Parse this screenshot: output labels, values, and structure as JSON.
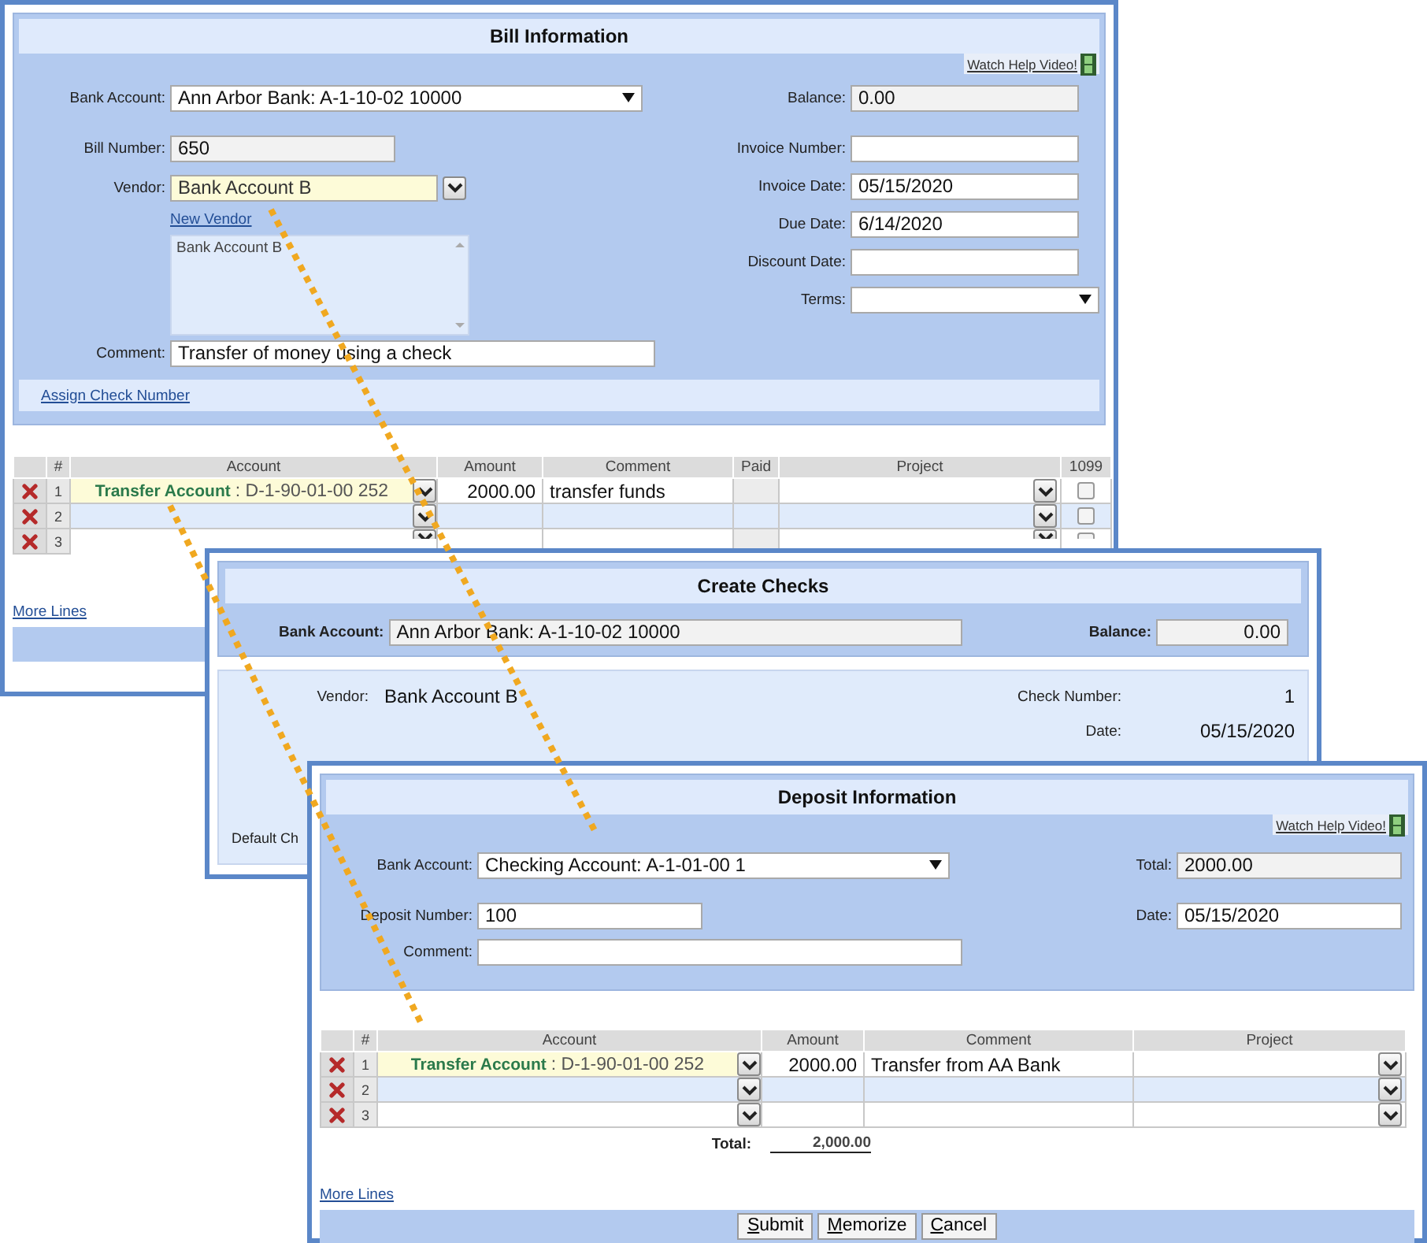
{
  "bill": {
    "title": "Bill Information",
    "help_link": "Watch Help Video!",
    "bank_account": {
      "label": "Bank Account:",
      "value": "Ann Arbor Bank: A-1-10-02 10000"
    },
    "bill_number": {
      "label": "Bill Number:",
      "value": "650"
    },
    "vendor": {
      "label": "Vendor:",
      "value": "Bank Account B"
    },
    "new_vendor_link": "New Vendor",
    "vendor_list": [
      "Bank Account B"
    ],
    "comment": {
      "label": "Comment:",
      "value": "Transfer of money using a check"
    },
    "right_fields": [
      {
        "label": "Balance:",
        "value": "0.00",
        "kind": "readonly"
      },
      {
        "label": "Invoice Number:",
        "kind": "text"
      },
      {
        "label": "Invoice Date:",
        "value": "05/15/2020",
        "kind": "text"
      },
      {
        "label": "Due Date:",
        "value": "6/14/2020",
        "kind": "text"
      },
      {
        "label": "Discount Date:",
        "kind": "text"
      },
      {
        "label": "Terms:",
        "kind": "select"
      }
    ],
    "assign_link": "Assign Check Number",
    "columns": [
      "#",
      "Account",
      "Amount",
      "Comment",
      "Paid",
      "Project",
      "1099"
    ],
    "rows": [
      {
        "number": "1",
        "highlighted": true,
        "account_name": "Transfer Account",
        "account_code": ": D-1-90-01-00 252",
        "amount": "2000.00",
        "comment": "transfer funds",
        "form_1099": false
      },
      {
        "number": "2",
        "highlighted": false,
        "form_1099": false
      },
      {
        "number": "3",
        "highlighted": false,
        "form_1099": false
      }
    ],
    "more_lines": "More Lines"
  },
  "checks": {
    "title": "Create Checks",
    "bank_account": {
      "label": "Bank Account:",
      "value": "Ann Arbor Bank: A-1-10-02 10000"
    },
    "balance": {
      "label": "Balance:",
      "value": "0.00"
    },
    "vendor": {
      "label": "Vendor:",
      "value": "Bank Account B"
    },
    "check_number": {
      "label": "Check Number:",
      "value": "1"
    },
    "date": {
      "label": "Date:",
      "value": "05/15/2020"
    },
    "default_label": "Default Ch"
  },
  "deposit": {
    "title": "Deposit Information",
    "help_link": "Watch Help Video!",
    "bank_account": {
      "label": "Bank Account:",
      "value": "Checking Account: A-1-01-00 1"
    },
    "deposit_number": {
      "label": "Deposit Number:",
      "value": "100"
    },
    "comment": {
      "label": "Comment:"
    },
    "total": {
      "label": "Total:",
      "value": "2000.00"
    },
    "date": {
      "label": "Date:",
      "value": "05/15/2020"
    },
    "columns": [
      "#",
      "Account",
      "Amount",
      "Comment",
      "Project"
    ],
    "rows": [
      {
        "number": "1",
        "highlighted": true,
        "account_name": "Transfer Account",
        "account_code": ": D-1-90-01-00 252",
        "amount": "2000.00",
        "comment": "Transfer from AA Bank"
      },
      {
        "number": "2",
        "highlighted": false
      },
      {
        "number": "3",
        "highlighted": false
      }
    ],
    "total_row": {
      "label": "Total:",
      "value": "2,000.00"
    },
    "more_lines": "More Lines",
    "buttons": [
      "Submit",
      "Memorize",
      "Cancel"
    ]
  }
}
